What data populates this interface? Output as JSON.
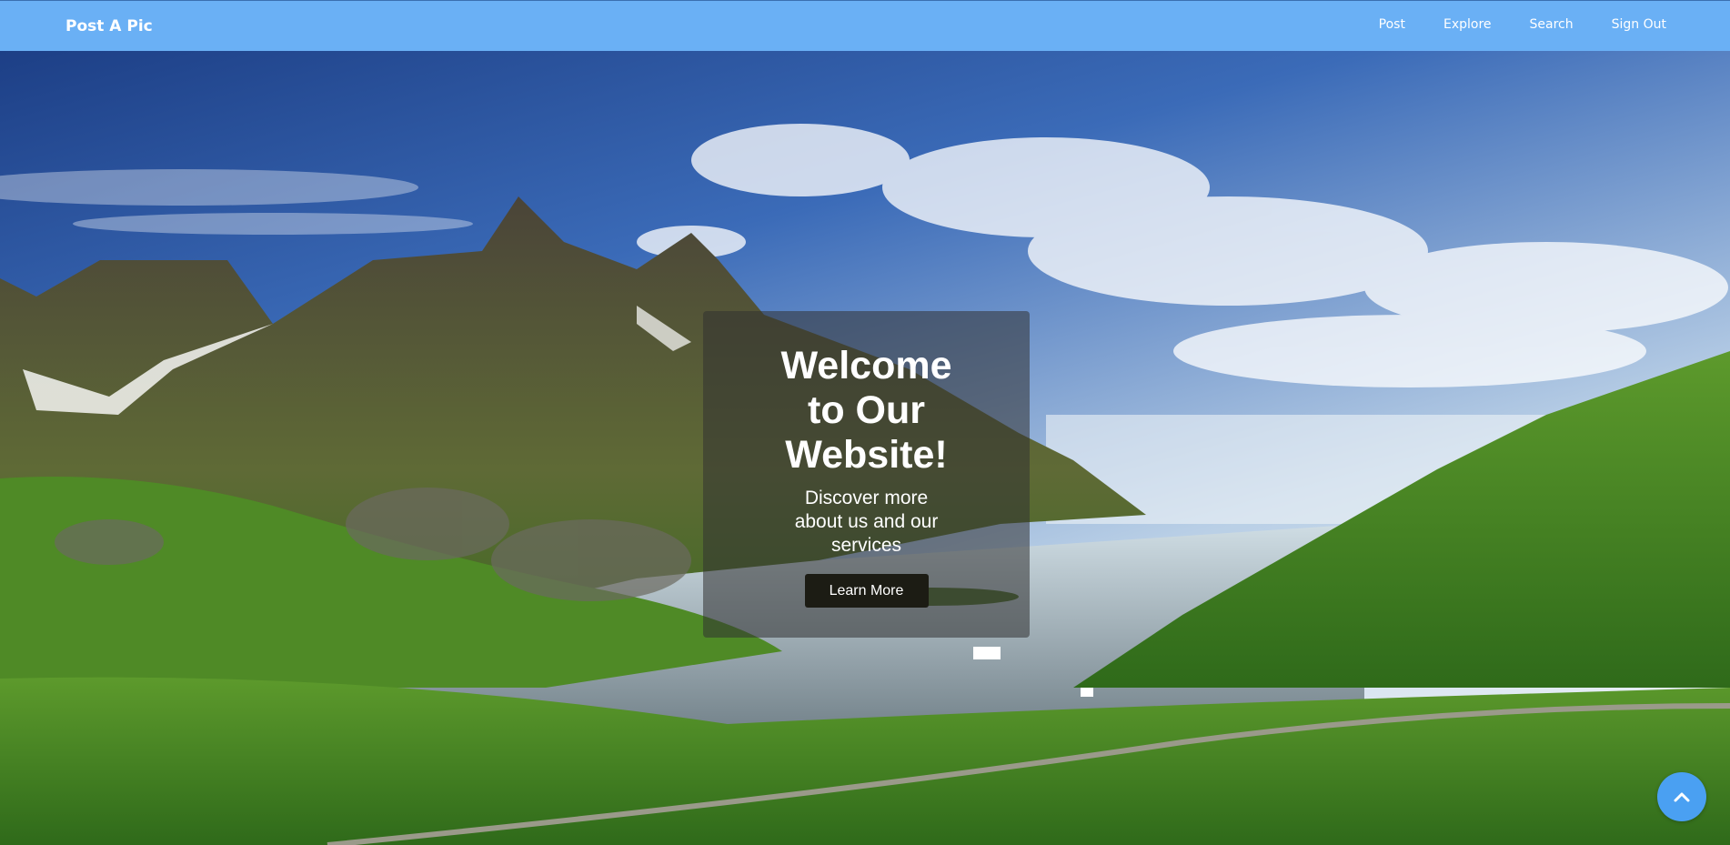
{
  "navbar": {
    "brand": "Post A Pic",
    "links": [
      "Post",
      "Explore",
      "Search",
      "Sign Out"
    ],
    "background_color": "#6ab0f5"
  },
  "hero": {
    "title": "Welcome to Our Website!",
    "subtitle": "Discover more about us and our services",
    "button_label": "Learn More",
    "background_description_icon": "mountain-fjord-landscape-image"
  },
  "scroll_top_button": {
    "icon": "chevron-up-icon",
    "color": "#4aa0f2"
  }
}
